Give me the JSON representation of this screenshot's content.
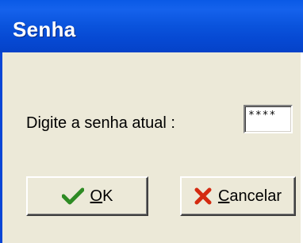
{
  "window": {
    "title": "Senha"
  },
  "form": {
    "prompt_label": "Digite a senha atual :",
    "password_value": "****"
  },
  "buttons": {
    "ok": {
      "mnemonic": "O",
      "rest": "K",
      "icon": "checkmark-icon",
      "icon_color": "#2e8b24"
    },
    "cancel": {
      "mnemonic": "C",
      "rest": "ancelar",
      "icon": "x-icon",
      "icon_color": "#d42a10"
    }
  },
  "colors": {
    "titlebar": "#0a53dc",
    "window_bg": "#ece9d8"
  }
}
